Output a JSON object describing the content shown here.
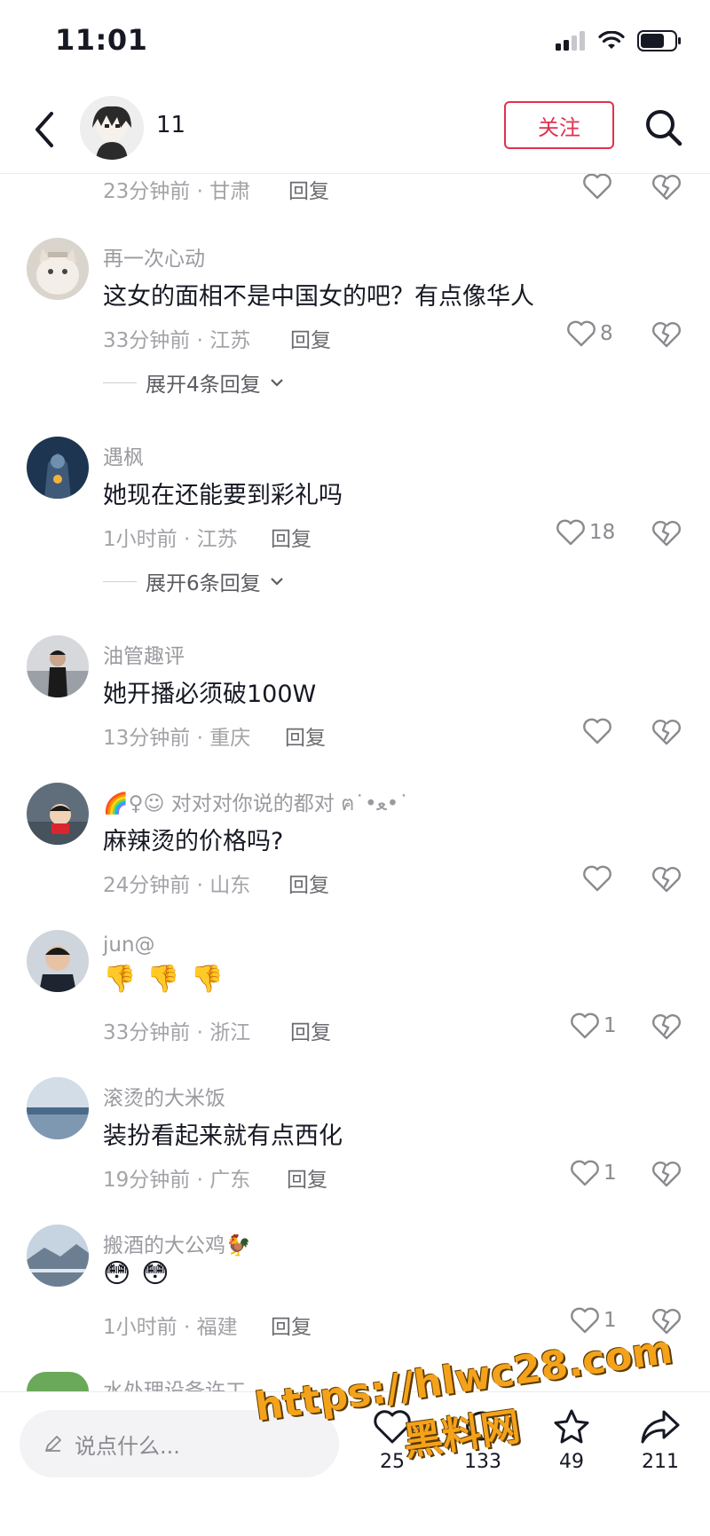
{
  "status": {
    "time": "11:01"
  },
  "header": {
    "title": "11",
    "follow_label": "关注"
  },
  "top_partial": {
    "meta": "23分钟前 · 甘肃",
    "reply": "回复"
  },
  "comments": [
    {
      "username": "再一次心动",
      "text": "这女的面相不是中国女的吧？有点像华人",
      "meta": "33分钟前 · 江苏",
      "reply": "回复",
      "likes": "8",
      "expand": "展开4条回复"
    },
    {
      "username": "遇枫",
      "text": "她现在还能要到彩礼吗",
      "meta": "1小时前 · 江苏",
      "reply": "回复",
      "likes": "18",
      "expand": "展开6条回复"
    },
    {
      "username": "油管趣评",
      "text": "她开播必须破100W",
      "meta": "13分钟前 · 重庆",
      "reply": "回复",
      "likes": ""
    },
    {
      "username": "🌈♀☺ 对对对你说的都对 ฅ˙•ﻌ•˙",
      "text": "麻辣烫的价格吗?",
      "meta": "24分钟前 · 山东",
      "reply": "回复",
      "likes": ""
    },
    {
      "username": "jun@",
      "text": "",
      "emoji": [
        "👎",
        "👎",
        "👎"
      ],
      "meta": "33分钟前 · 浙江",
      "reply": "回复",
      "likes": "1"
    },
    {
      "username": "滚烫的大米饭",
      "text": "装扮看起来就有点西化",
      "meta": "19分钟前 · 广东",
      "reply": "回复",
      "likes": "1"
    },
    {
      "username": "搬酒的大公鸡🐓",
      "text": "",
      "emoji": [
        "😳",
        "😳"
      ],
      "meta": "1小时前 · 福建",
      "reply": "回复",
      "likes": "1"
    },
    {
      "username": "水处理设备许工"
    }
  ],
  "bottom": {
    "placeholder": "说点什么...",
    "like_count": "25",
    "comment_count": "133",
    "star_count": "49",
    "share_count": "211"
  },
  "watermark": {
    "line1": "https://hlwc28.com",
    "line2": "黑料网"
  },
  "colors": {
    "accent": "#e0314f",
    "text": "#161823",
    "muted": "#a3a3a8"
  }
}
